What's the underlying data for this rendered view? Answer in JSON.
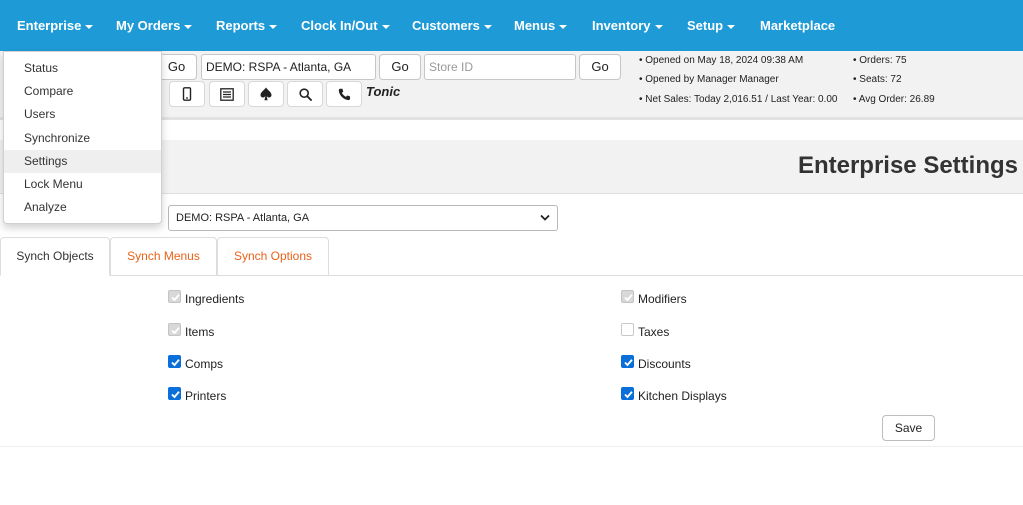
{
  "nav": {
    "items": [
      {
        "label": "Enterprise",
        "caret": true
      },
      {
        "label": "My Orders",
        "caret": true
      },
      {
        "label": "Reports",
        "caret": true
      },
      {
        "label": "Clock In/Out",
        "caret": true
      },
      {
        "label": "Customers",
        "caret": true
      },
      {
        "label": "Menus",
        "caret": true
      },
      {
        "label": "Inventory",
        "caret": true
      },
      {
        "label": "Setup",
        "caret": true
      },
      {
        "label": "Marketplace",
        "caret": false
      }
    ],
    "bar_color": "#1e9ad6"
  },
  "enterprise_menu": {
    "items": [
      "Status",
      "Compare",
      "Users",
      "Synchronize",
      "Settings",
      "Lock Menu",
      "Analyze"
    ],
    "highlighted": "Settings"
  },
  "toolbar": {
    "go_label": "Go",
    "store_value": "DEMO: RSPA - Atlanta, GA",
    "store_id_placeholder": "Store ID",
    "icons": [
      "mobile-icon",
      "list-icon",
      "spade-icon",
      "search-icon",
      "phone-icon"
    ],
    "brand": "Tonic"
  },
  "stats": {
    "opened_on": "• Opened on May 18, 2024 09:38 AM",
    "opened_by": "• Opened by Manager Manager",
    "net_sales": "• Net Sales: Today 2,016.51 / Last Year: 0.00",
    "orders": "• Orders: 75",
    "seats": "• Seats: 72",
    "avg_order": "• Avg Order: 26.89"
  },
  "page": {
    "title": "Enterprise Settings",
    "store_select": "DEMO: RSPA - Atlanta, GA"
  },
  "tabs": [
    {
      "label": "Synch Objects",
      "active": true
    },
    {
      "label": "Synch Menus",
      "active": false
    },
    {
      "label": "Synch Options",
      "active": false
    }
  ],
  "synch_objects": [
    {
      "label": "Ingredients",
      "state": "checked-disabled"
    },
    {
      "label": "Modifiers",
      "state": "checked-disabled"
    },
    {
      "label": "Items",
      "state": "checked-disabled"
    },
    {
      "label": "Taxes",
      "state": "unchecked-disabled"
    },
    {
      "label": "Comps",
      "state": "checked"
    },
    {
      "label": "Discounts",
      "state": "checked"
    },
    {
      "label": "Printers",
      "state": "checked"
    },
    {
      "label": "Kitchen Displays",
      "state": "checked"
    }
  ],
  "save_label": "Save",
  "colors": {
    "accent_tab": "#e8621a",
    "checkbox": "#0b6fd9"
  }
}
